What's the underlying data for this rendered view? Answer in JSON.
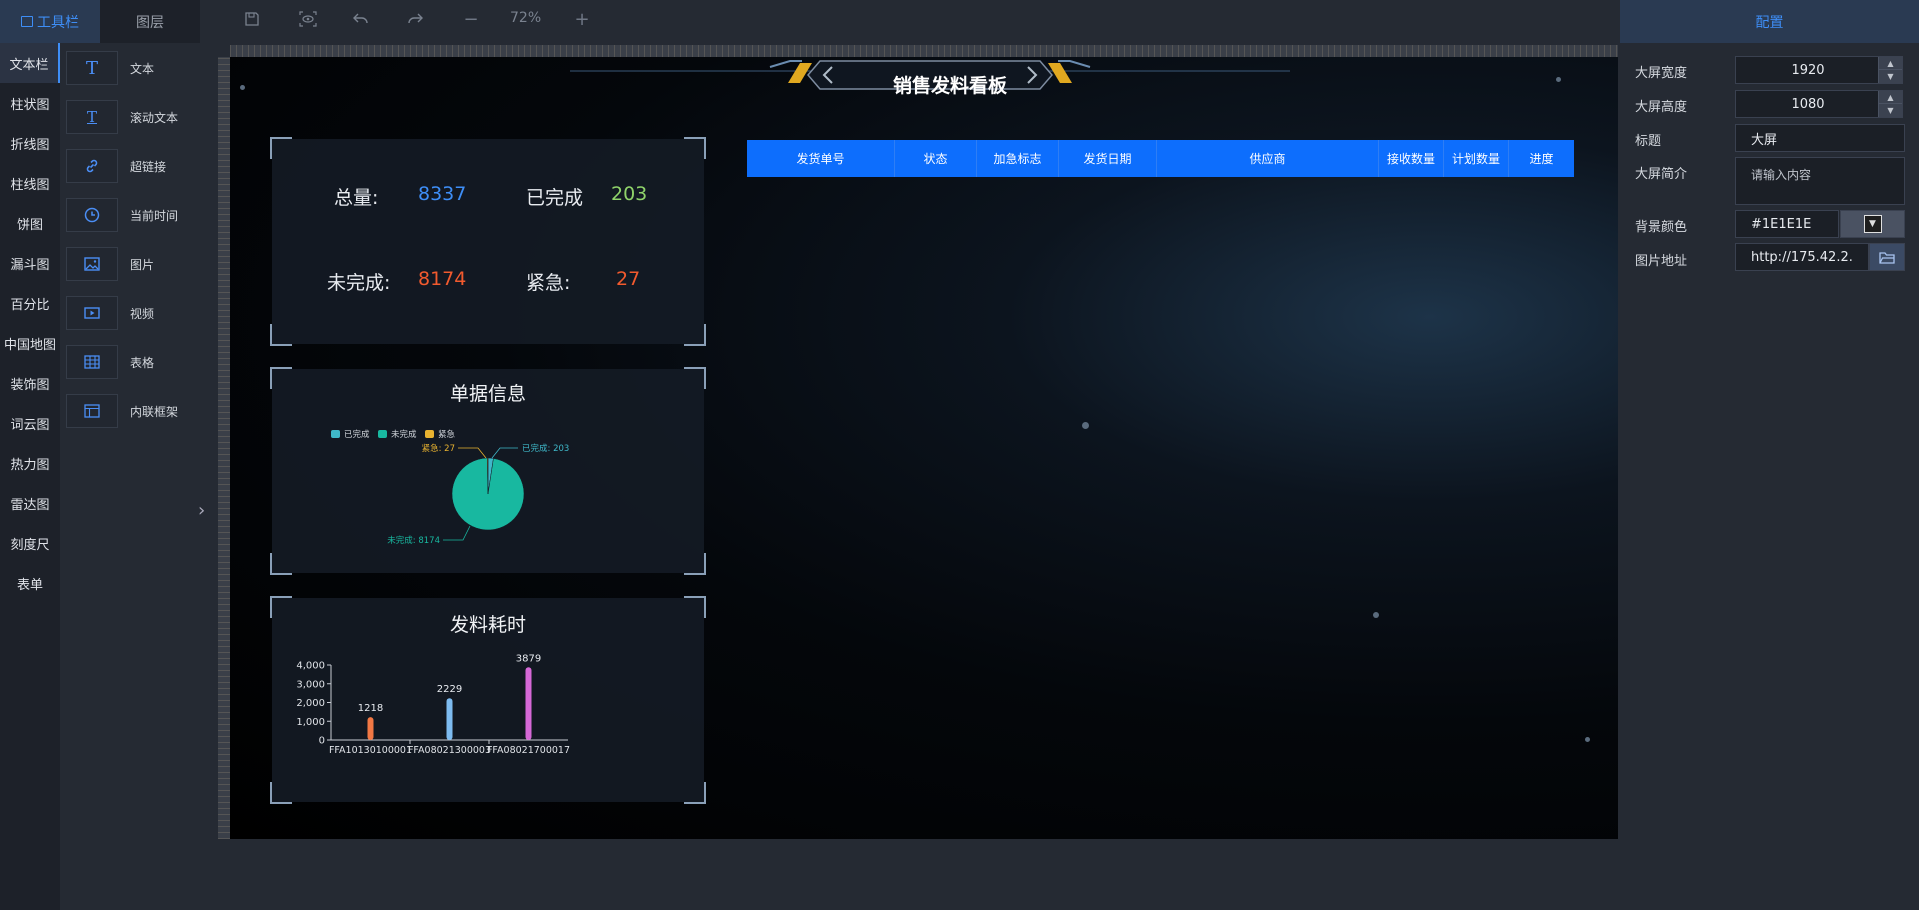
{
  "left_tabs": {
    "toolbar": "工具栏",
    "layers": "图层"
  },
  "categories": [
    "文本栏",
    "柱状图",
    "折线图",
    "柱线图",
    "饼图",
    "漏斗图",
    "百分比",
    "中国地图",
    "装饰图",
    "词云图",
    "热力图",
    "雷达图",
    "刻度尺",
    "表单"
  ],
  "components": [
    {
      "label": "文本",
      "icon": "text-icon"
    },
    {
      "label": "滚动文本",
      "icon": "scroll-text-icon"
    },
    {
      "label": "超链接",
      "icon": "link-icon"
    },
    {
      "label": "当前时间",
      "icon": "clock-icon"
    },
    {
      "label": "图片",
      "icon": "image-icon"
    },
    {
      "label": "视频",
      "icon": "video-icon"
    },
    {
      "label": "表格",
      "icon": "table-icon"
    },
    {
      "label": "内联框架",
      "icon": "iframe-icon"
    }
  ],
  "toolbar": {
    "zoom": "72%"
  },
  "board": {
    "title": "销售发料看板",
    "stats": {
      "total_label": "总量:",
      "total_value": "8337",
      "done_label": "已完成",
      "done_value": "203",
      "pending_label": "未完成:",
      "pending_value": "8174",
      "urgent_label": "紧急:",
      "urgent_value": "27"
    },
    "table_headers": [
      "发货单号",
      "状态",
      "加急标志",
      "发货日期",
      "供应商",
      "接收数量",
      "计划数量",
      "进度"
    ]
  },
  "chart_data": [
    {
      "type": "pie",
      "title": "单据信息",
      "legend": [
        "已完成",
        "未完成",
        "紧急"
      ],
      "slices": [
        {
          "name": "已完成",
          "value": 203,
          "label": "已完成: 203",
          "color": "#3fb8c9"
        },
        {
          "name": "未完成",
          "value": 8174,
          "label": "未完成: 8174",
          "color": "#18b8a0"
        },
        {
          "name": "紧急",
          "value": 27,
          "label": "紧急: 27",
          "color": "#e8b230"
        }
      ]
    },
    {
      "type": "bar",
      "title": "发料耗时",
      "categories": [
        "FFA10130100001",
        "FFA08021300003",
        "FFA08021700017"
      ],
      "values": [
        1218,
        2229,
        3879
      ],
      "colors": [
        "#f27844",
        "#7dbbf0",
        "#d568d6"
      ],
      "ylim": [
        0,
        4000
      ],
      "yticks": [
        "0",
        "1,000",
        "2,000",
        "3,000",
        "4,000"
      ]
    }
  ],
  "config": {
    "title": "配置",
    "fields": [
      {
        "label": "大屏宽度",
        "value": "1920"
      },
      {
        "label": "大屏高度",
        "value": "1080"
      },
      {
        "label": "标题",
        "value": "大屏"
      },
      {
        "label": "大屏简介",
        "value": "请输入内容"
      },
      {
        "label": "背景颜色",
        "value": "#1E1E1E"
      },
      {
        "label": "图片地址",
        "value": "http://175.42.2."
      }
    ]
  },
  "colors": {
    "accent": "#3e8ef7",
    "table_header": "#0d6efd",
    "stat_blue": "#3e8ef7",
    "stat_green": "#8fd36a",
    "stat_red": "#f25a2e"
  }
}
